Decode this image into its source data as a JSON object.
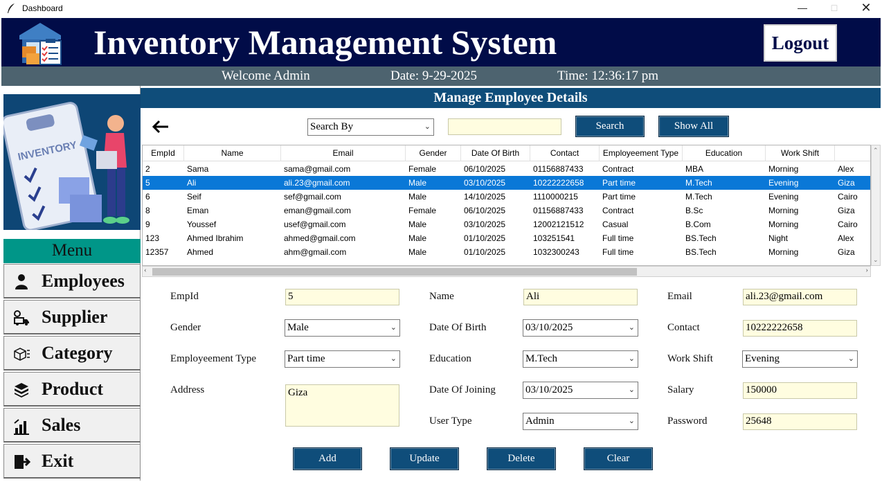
{
  "window": {
    "title": "Dashboard"
  },
  "header": {
    "title": "Inventory Management System",
    "logout_label": "Logout"
  },
  "subbar": {
    "welcome": "Welcome Admin",
    "date": "Date: 9-29-2025",
    "time": "Time: 12:36:17 pm"
  },
  "sidebar": {
    "menu_title": "Menu",
    "items": [
      {
        "label": "Employees",
        "icon": "user-icon"
      },
      {
        "label": "Supplier",
        "icon": "truck-icon"
      },
      {
        "label": "Category",
        "icon": "category-icon"
      },
      {
        "label": "Product",
        "icon": "box-icon"
      },
      {
        "label": "Sales",
        "icon": "bar-chart-icon"
      },
      {
        "label": "Exit",
        "icon": "exit-icon"
      }
    ],
    "image_text": "INVENTORY"
  },
  "main": {
    "heading": "Manage Employee Details",
    "search": {
      "by_selected": "Search By",
      "query": "",
      "search_label": "Search",
      "show_all_label": "Show All"
    },
    "table": {
      "columns": [
        "EmpId",
        "Name",
        "Email",
        "Gender",
        "Date Of Birth",
        "Contact",
        "Employeement Type",
        "Education",
        "Work Shift"
      ],
      "rows": [
        [
          "2",
          "Sama",
          "sama@gmail.com",
          "Female",
          "06/10/2025",
          "01156887433",
          "Contract",
          "MBA",
          "Morning",
          "Alex"
        ],
        [
          "5",
          "Ali",
          "ali.23@gmail.com",
          "Male",
          "03/10/2025",
          "10222222658",
          "Part time",
          "M.Tech",
          "Evening",
          "Giza"
        ],
        [
          "6",
          "Seif",
          "sef@gmail.com",
          "Male",
          "14/10/2025",
          "1110000215",
          "Part time",
          "M.Tech",
          "Evening",
          "Cairo"
        ],
        [
          "8",
          "Eman",
          "eman@gmail.com",
          "Female",
          "06/10/2025",
          "01156887433",
          "Contract",
          "B.Sc",
          "Morning",
          "Giza"
        ],
        [
          "9",
          "Youssef",
          "usef@gmail.com",
          "Male",
          "03/10/2025",
          "12002121512",
          "Casual",
          "B.Com",
          "Morning",
          "Cairo"
        ],
        [
          "123",
          "Ahmed Ibrahim",
          "ahmed@gmail.com",
          "Male",
          "01/10/2025",
          "103251541",
          "Full time",
          "BS.Tech",
          "Night",
          "Alex"
        ],
        [
          "12357",
          "Ahmed",
          "ahm@gmail.com",
          "Male",
          "01/10/2025",
          "1032300243",
          "Full time",
          "BS.Tech",
          "Morning",
          "Giza"
        ]
      ],
      "selected_row": 1
    },
    "form": {
      "empid": {
        "label": "EmpId",
        "value": "5"
      },
      "name": {
        "label": "Name",
        "value": "Ali"
      },
      "email": {
        "label": "Email",
        "value": "ali.23@gmail.com"
      },
      "gender": {
        "label": "Gender",
        "value": "Male"
      },
      "dob": {
        "label": "Date Of Birth",
        "value": "03/10/2025"
      },
      "contact": {
        "label": "Contact",
        "value": "10222222658"
      },
      "emp_type": {
        "label": "Employeement Type",
        "value": "Part time"
      },
      "education": {
        "label": "Education",
        "value": "M.Tech"
      },
      "work_shift": {
        "label": "Work Shift",
        "value": "Evening"
      },
      "address": {
        "label": "Address",
        "value": "Giza"
      },
      "doj": {
        "label": "Date Of Joining",
        "value": "03/10/2025"
      },
      "salary": {
        "label": "Salary",
        "value": "150000"
      },
      "user_type": {
        "label": "User Type",
        "value": "Admin"
      },
      "password": {
        "label": "Password",
        "value": "25648"
      }
    },
    "buttons": {
      "add": "Add",
      "update": "Update",
      "delete": "Delete",
      "clear": "Clear"
    }
  },
  "colors": {
    "header_bg": "#010c48",
    "subbar_bg": "#4d636f",
    "accent": "#0f4d7a",
    "menu_header": "#009688",
    "input_bg": "#fffde0",
    "selected_row": "#0a78d7"
  }
}
